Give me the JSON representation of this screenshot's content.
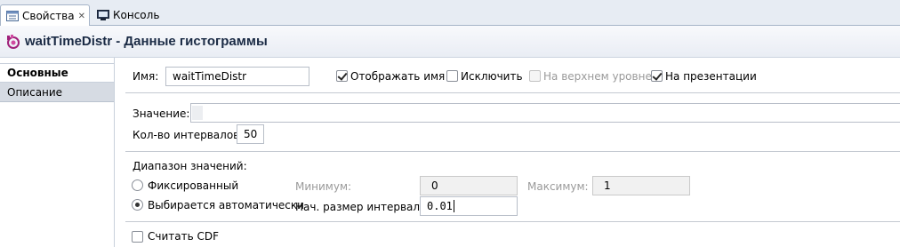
{
  "tabs": [
    {
      "label": "Свойства",
      "active": true,
      "icon": "properties-icon"
    },
    {
      "label": "Консоль",
      "active": false,
      "icon": "console-icon"
    }
  ],
  "header": {
    "title": "waitTimeDistr - Данные гистограммы",
    "icon": "histogram-data-icon"
  },
  "sidebar": {
    "items": [
      {
        "label": "Основные",
        "selected": true
      },
      {
        "label": "Описание",
        "selected": false
      }
    ]
  },
  "form": {
    "name_label": "Имя:",
    "name_value": "waitTimeDistr",
    "show_name_label": "Отображать имя",
    "show_name_checked": true,
    "exclude_label": "Исключить",
    "exclude_checked": false,
    "top_level_label": "На верхнем уровне",
    "top_level_checked": false,
    "on_presentation_label": "На презентации",
    "on_presentation_checked": true,
    "value_label": "Значение:",
    "value_value": "",
    "intervals_label": "Кол-во интервалов:",
    "intervals_value": "50",
    "range_label": "Диапазон значений:",
    "fixed_label": "Фиксированный",
    "auto_label": "Выбирается автоматически",
    "range_mode": "auto",
    "min_label": "Минимум:",
    "min_value": "0",
    "max_label": "Максимум:",
    "max_value": "1",
    "interval_size_label": "Нач. размер интервала:",
    "interval_size_value": "0.01",
    "cdf_label": "Считать CDF",
    "cdf_checked": false
  },
  "colors": {
    "title_text": "#1b2b45",
    "tab_strip": "#e7ecf3",
    "nav_unselected": "#d6dbe3"
  }
}
